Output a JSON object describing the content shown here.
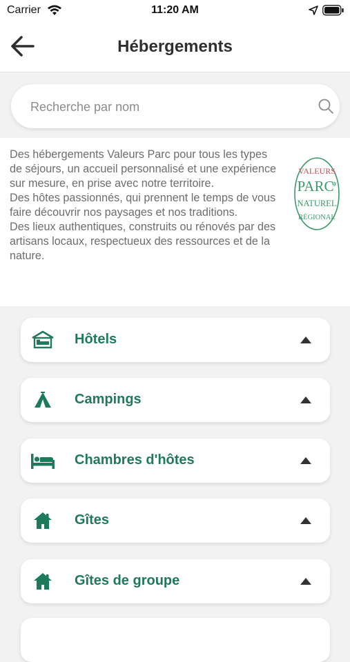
{
  "status_bar": {
    "carrier": "Carrier",
    "time": "11:20 AM"
  },
  "nav": {
    "title": "Hébergements",
    "back_icon": "arrow-left-icon"
  },
  "search": {
    "placeholder": "Recherche par nom",
    "value": "",
    "icon": "search-icon"
  },
  "intro": {
    "paragraphs": [
      "Des hébergements Valeurs Parc pour tous les types de séjours, un accueil personnalisé et une expérience sur mesure, en prise avec notre territoire.",
      "Des hôtes passionnés, qui prennent le temps de vous faire découvrir nos paysages et nos traditions.",
      "Des lieux authentiques, construits ou rénovés par des artisans locaux, respectueux des ressources et de la nature."
    ],
    "logo_text": [
      "VALEURS",
      "PARC",
      "NATUREL",
      "RÉGIONAL"
    ]
  },
  "categories": [
    {
      "label": "Hôtels",
      "icon": "hotel-icon"
    },
    {
      "label": "Campings",
      "icon": "tent-icon"
    },
    {
      "label": "Chambres d'hôtes",
      "icon": "bed-icon"
    },
    {
      "label": "Gîtes",
      "icon": "house-icon"
    },
    {
      "label": "Gîtes de groupe",
      "icon": "house-icon"
    }
  ],
  "colors": {
    "accent": "#1d7a5a",
    "logo_green": "#3a9a6a",
    "logo_red": "#d04a5a",
    "background": "#f2f2f2",
    "chevron": "#333333"
  }
}
